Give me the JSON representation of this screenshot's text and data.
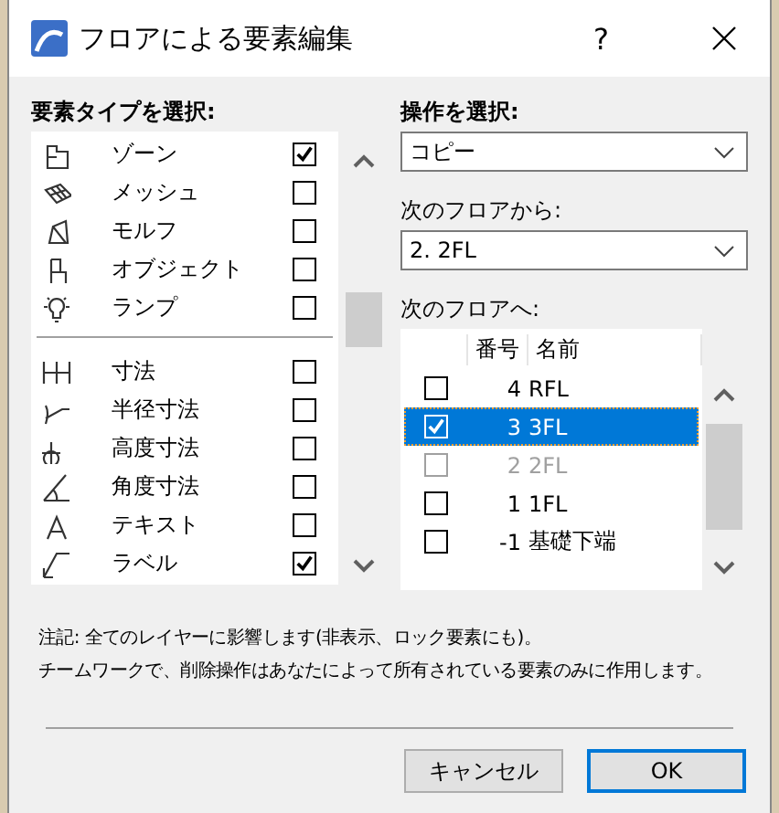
{
  "window": {
    "title": "フロアによる要素編集",
    "help": "?"
  },
  "element_types": {
    "label": "要素タイプを選択:",
    "groups": [
      {
        "items": [
          {
            "label": "ゾーン",
            "checked": true
          },
          {
            "label": "メッシュ",
            "checked": false
          },
          {
            "label": "モルフ",
            "checked": false
          },
          {
            "label": "オブジェクト",
            "checked": false
          },
          {
            "label": "ランプ",
            "checked": false
          }
        ]
      },
      {
        "items": [
          {
            "label": "寸法",
            "checked": false
          },
          {
            "label": "半径寸法",
            "checked": false
          },
          {
            "label": "高度寸法",
            "checked": false
          },
          {
            "label": "角度寸法",
            "checked": false
          },
          {
            "label": "テキスト",
            "checked": false
          },
          {
            "label": "ラベル",
            "checked": true
          }
        ]
      }
    ]
  },
  "operation": {
    "label": "操作を選択:",
    "value": "コピー"
  },
  "from_floor": {
    "label": "次のフロアから:",
    "value": "2. 2FL"
  },
  "to_floor": {
    "label": "次のフロアへ:",
    "columns": [
      "番号",
      "名前"
    ],
    "rows": [
      {
        "number": "4",
        "name": "RFL",
        "checked": false,
        "selected": false,
        "disabled": false
      },
      {
        "number": "3",
        "name": "3FL",
        "checked": true,
        "selected": true,
        "disabled": false
      },
      {
        "number": "2",
        "name": "2FL",
        "checked": false,
        "selected": false,
        "disabled": true
      },
      {
        "number": "1",
        "name": "1FL",
        "checked": false,
        "selected": false,
        "disabled": false
      },
      {
        "number": "-1",
        "name": "基礎下端",
        "checked": false,
        "selected": false,
        "disabled": false
      }
    ]
  },
  "note": [
    "注記: 全てのレイヤーに影響します(非表示、ロック要素にも)。",
    "チームワークで、削除操作はあなたによって所有されている要素のみに作用します。"
  ],
  "buttons": [
    {
      "label": "キャンセル",
      "default": false
    },
    {
      "label": "OK",
      "default": true
    }
  ]
}
